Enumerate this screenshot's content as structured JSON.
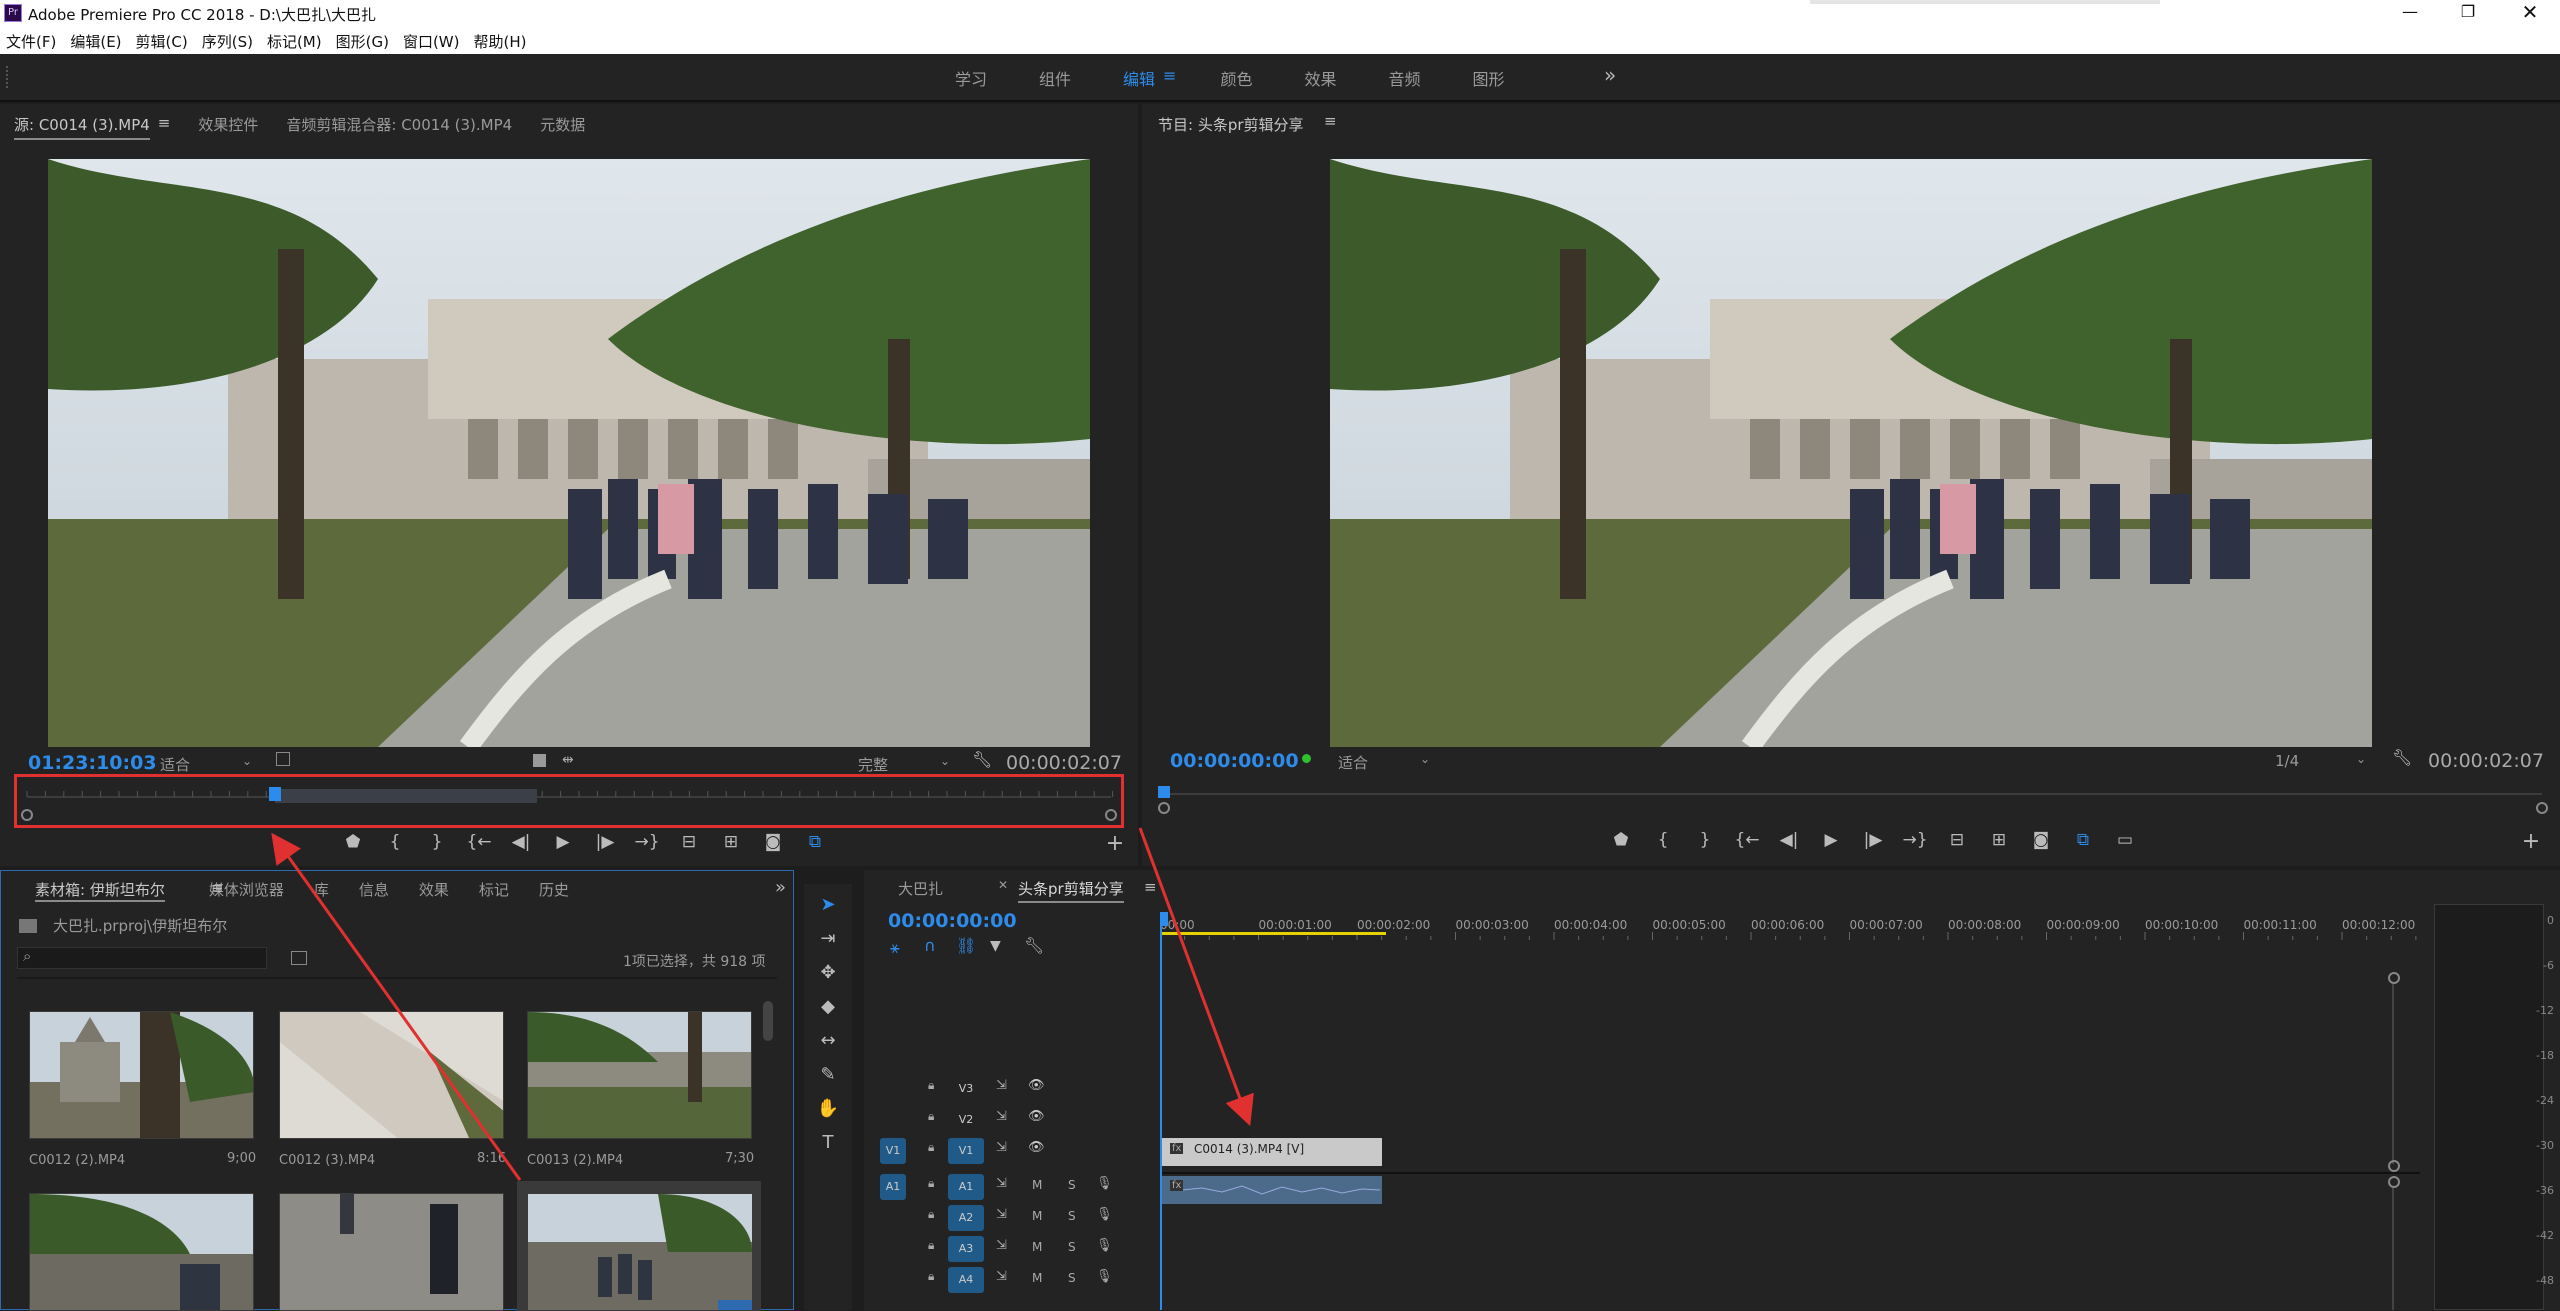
{
  "app": {
    "title": "Adobe Premiere Pro CC 2018 - D:\\大巴扎\\大巴扎",
    "logo_text": "Pr"
  },
  "menu": [
    "文件(F)",
    "编辑(E)",
    "剪辑(C)",
    "序列(S)",
    "标记(M)",
    "图形(G)",
    "窗口(W)",
    "帮助(H)"
  ],
  "workspaces": {
    "items": [
      "学习",
      "组件",
      "编辑",
      "颜色",
      "效果",
      "音频",
      "图形"
    ],
    "active": "编辑",
    "more": "»"
  },
  "source": {
    "tabs": [
      "源: C0014 (3).MP4",
      "效果控件",
      "音频剪辑混合器: C0014 (3).MP4",
      "元数据"
    ],
    "timecode": "01:23:10:03",
    "fit": "适合",
    "quality": "完整",
    "duration": "00:00:02:07"
  },
  "program": {
    "tab": "节目: 头条pr剪辑分享",
    "timecode": "00:00:00:00",
    "fit": "适合",
    "resolution": "1/4",
    "duration": "00:00:02:07"
  },
  "project": {
    "tabs": [
      "素材箱: 伊斯坦布尔",
      "媒体浏览器",
      "库",
      "信息",
      "效果",
      "标记",
      "历史"
    ],
    "path": "大巴扎.prproj\\伊斯坦布尔",
    "selection": "1项已选择，共 918 项",
    "clips": [
      {
        "name": "C0012 (2).MP4",
        "duration": "9;00"
      },
      {
        "name": "C0012 (3).MP4",
        "duration": "8:16"
      },
      {
        "name": "C0013 (2).MP4",
        "duration": "7;30"
      }
    ]
  },
  "timeline": {
    "tabs": [
      "大巴扎",
      "头条pr剪辑分享"
    ],
    "timecode": "00:00:00:00",
    "ruler": [
      "00:00",
      "00:00:01:00",
      "00:00:02:00",
      "00:00:03:00",
      "00:00:04:00",
      "00:00:05:00",
      "00:00:06:00",
      "00:00:07:00",
      "00:00:08:00",
      "00:00:09:00",
      "00:00:10:00",
      "00:00:11:00",
      "00:00:12:00"
    ],
    "video_tracks": [
      "V3",
      "V2",
      "V1"
    ],
    "audio_tracks": [
      "A1",
      "A2",
      "A3",
      "A4"
    ],
    "source_patch_v": "V1",
    "source_patch_a": "A1",
    "track_m": "M",
    "track_s": "S",
    "video_clip": "C0014 (3).MP4 [V]",
    "fx_badge": "fx"
  },
  "meter": {
    "labels": [
      "0",
      "-6",
      "-12",
      "-18",
      "-24",
      "-30",
      "-36",
      "-42",
      "-48"
    ]
  },
  "icons": {
    "accent": "#2d8ceb",
    "highlight": "#e03030"
  }
}
